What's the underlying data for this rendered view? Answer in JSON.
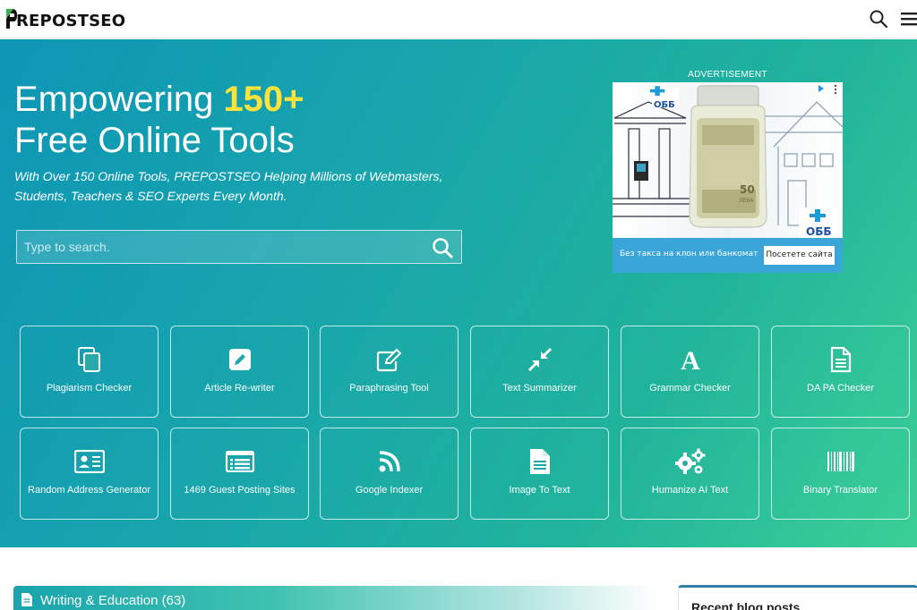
{
  "header": {
    "logo_text": "REPOSTSEO",
    "search_icon": "search-icon",
    "menu_icon": "hamburger-menu-icon"
  },
  "hero": {
    "title_prefix": "Empowering ",
    "title_highlight": "150+",
    "title_line2": "Free Online Tools",
    "subtitle": "With Over 150 Online Tools, PREPOSTSEO Helping Millions of Webmasters, Students, Teachers & SEO Experts Every Month.",
    "search_placeholder": "Type to search.",
    "accent_color": "#ffe33a"
  },
  "ad": {
    "label": "ADVERTISEMENT",
    "brand": "ОББ",
    "caption": "Без такса на клон или банкомат",
    "cta": "Посетете сайта",
    "banknote": "50",
    "banknote_unit": "ЛЕВА"
  },
  "tools": [
    {
      "label": "Plagiarism Checker",
      "icon": "copy-icon"
    },
    {
      "label": "Article Re-writer",
      "icon": "pencil-square-icon"
    },
    {
      "label": "Paraphrasing Tool",
      "icon": "edit-icon"
    },
    {
      "label": "Text Summarizer",
      "icon": "compress-icon"
    },
    {
      "label": "Grammar Checker",
      "icon": "letter-a-icon"
    },
    {
      "label": "DA PA Checker",
      "icon": "document-icon"
    },
    {
      "label": "Random Address Generator",
      "icon": "id-card-icon"
    },
    {
      "label": "1469 Guest Posting Sites",
      "icon": "list-icon"
    },
    {
      "label": "Google Indexer",
      "icon": "rss-icon"
    },
    {
      "label": "Image To Text",
      "icon": "file-text-icon"
    },
    {
      "label": "Humanize AI Text",
      "icon": "gears-icon"
    },
    {
      "label": "Binary Translator",
      "icon": "barcode-icon"
    }
  ],
  "sections": {
    "category_title": "Writing & Education (63)",
    "blog_title": "Recent blog posts"
  }
}
